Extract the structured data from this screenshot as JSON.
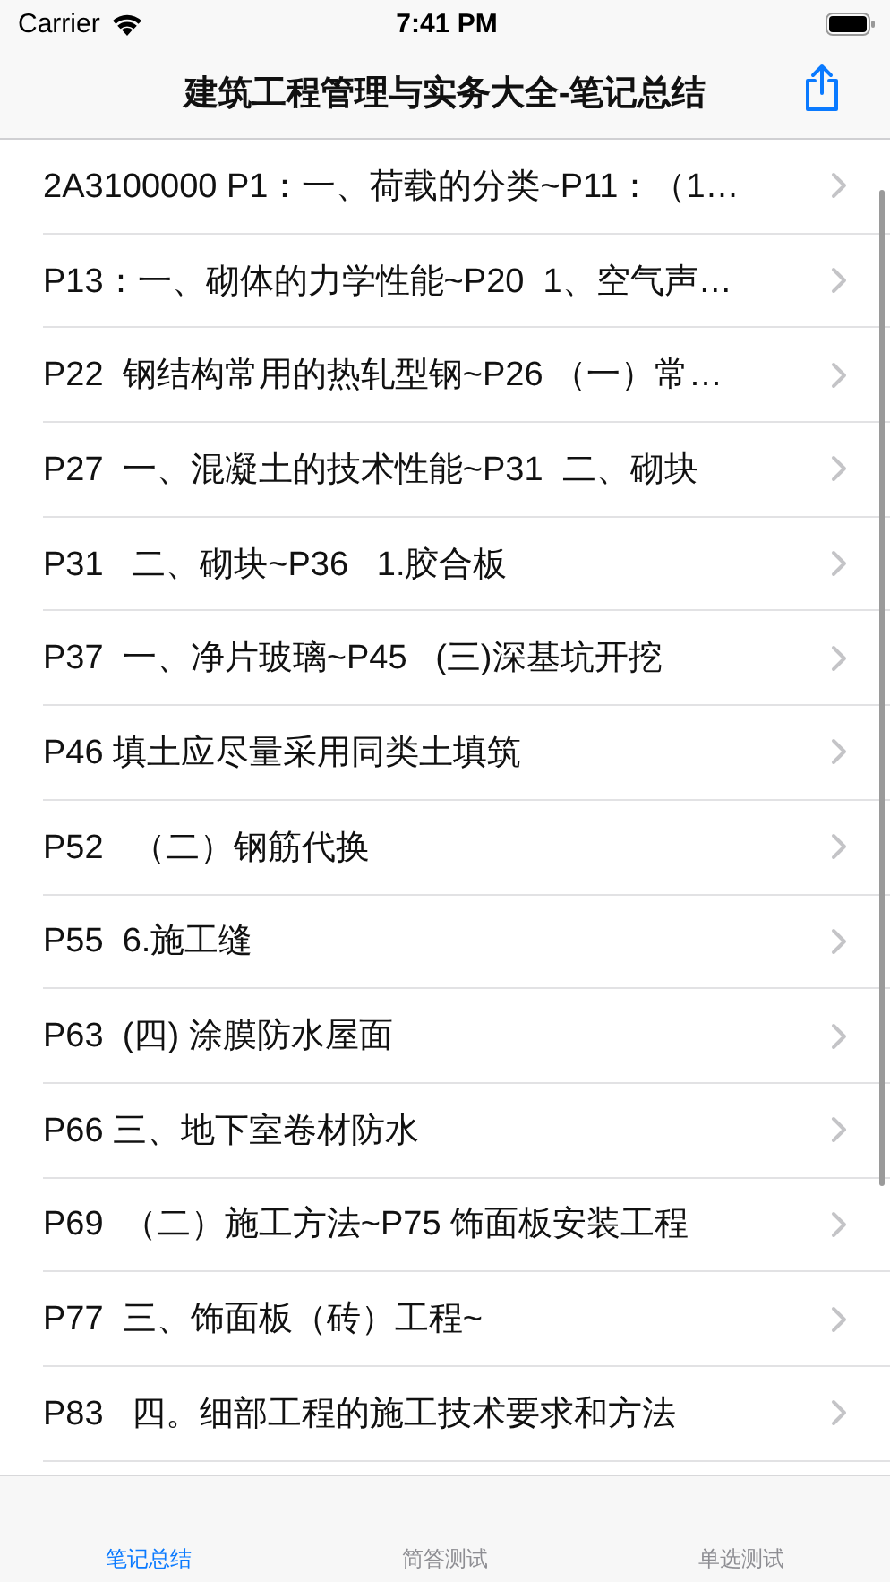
{
  "status_bar": {
    "carrier": "Carrier",
    "time": "7:41 PM"
  },
  "nav": {
    "title": "建筑工程管理与实务大全-笔记总结"
  },
  "rows": [
    {
      "text": "2A3100000 P1：一、荷载的分类~P11：（1…"
    },
    {
      "text": "P13：一、砌体的力学性能~P20  1、空气声…"
    },
    {
      "text": "P22  钢结构常用的热轧型钢~P26 （一）常…"
    },
    {
      "text": "P27  一、混凝土的技术性能~P31  二、砌块"
    },
    {
      "text": "P31   二、砌块~P36   1.胶合板"
    },
    {
      "text": "P37  一、净片玻璃~P45   (三)深基坑开挖"
    },
    {
      "text": "P46 填土应尽量采用同类土填筑"
    },
    {
      "text": "P52   （二）钢筋代换"
    },
    {
      "text": "P55  6.施工缝"
    },
    {
      "text": "P63  (四) 涂膜防水屋面"
    },
    {
      "text": "P66 三、地下室卷材防水"
    },
    {
      "text": "P69  （二）施工方法~P75 饰面板安装工程"
    },
    {
      "text": "P77  三、饰面板（砖）工程~"
    },
    {
      "text": "P83   四。细部工程的施工技术要求和方法"
    }
  ],
  "tabs": [
    {
      "label": "笔记总结",
      "selected": true
    },
    {
      "label": "简答测试",
      "selected": false
    },
    {
      "label": "单选测试",
      "selected": false
    }
  ]
}
